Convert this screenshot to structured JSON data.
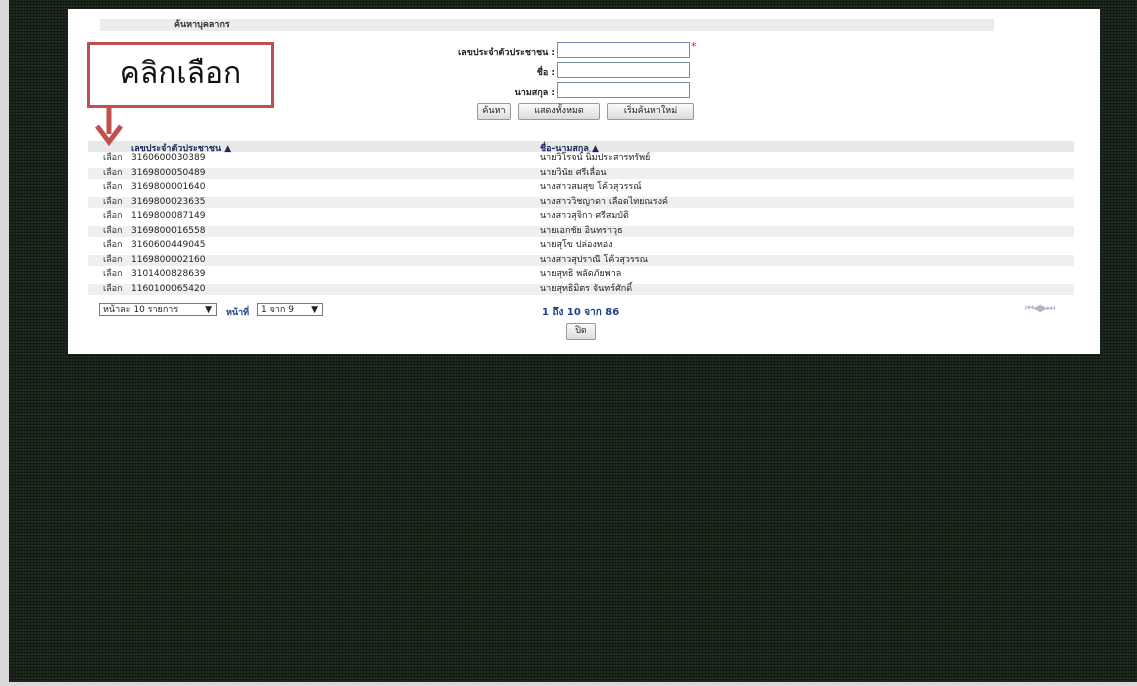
{
  "section_title": "ค้นหาบุคลากร",
  "form": {
    "id_label": "เลขประจำตัวประชาชน :",
    "name_label": "ชื่อ :",
    "surname_label": "นามสกุล :",
    "id_value": "",
    "name_value": "",
    "surname_value": "",
    "required_mark": "*"
  },
  "buttons": {
    "search": "ค้นหา",
    "show_all": "แสดงทั้งหมด",
    "reset": "เริ่มค้นหาใหม่",
    "close": "ปิด"
  },
  "callout": {
    "text": "คลิกเลือก"
  },
  "table": {
    "columns": [
      "เลขประจำตัวประชาชน ▲",
      "ชื่อ-นามสกุล ▲"
    ],
    "select_label": "เลือก",
    "rows": [
      {
        "id": "3160600030389",
        "name": "นายวิโรจน์ นิ่มประสารทรัพย์"
      },
      {
        "id": "3169800050489",
        "name": "นายวินัย ศรีเลื่อน"
      },
      {
        "id": "3169800001640",
        "name": "นางสาวสมสุข โค้วสุวรรณ์"
      },
      {
        "id": "3169800023635",
        "name": "นางสาววิชญาดา เลือดไทยณรงค์"
      },
      {
        "id": "1169800087149",
        "name": "นางสาวสุจิกา ศรีสมบัติ"
      },
      {
        "id": "3169800016558",
        "name": "นายเอกชัย อินทราวุธ"
      },
      {
        "id": "3160600449045",
        "name": "นายสุโข ปล่องทอง"
      },
      {
        "id": "1169800002160",
        "name": "นางสาวสุปราณี โค้วสุวรรณ"
      },
      {
        "id": "3101400828639",
        "name": "นายสุทธิ พลัดภัยพาล"
      },
      {
        "id": "1160100065420",
        "name": "นายสุทธิมิตร จันทร์ศักดิ์"
      }
    ]
  },
  "pager": {
    "per_page": "หน้าละ 10 รายการ",
    "page_label": "หน้าที่",
    "page_value": "1 จาก 9",
    "range": "1 ถึง 10 จาก 86",
    "nav": "⏮◀▶⏭"
  }
}
